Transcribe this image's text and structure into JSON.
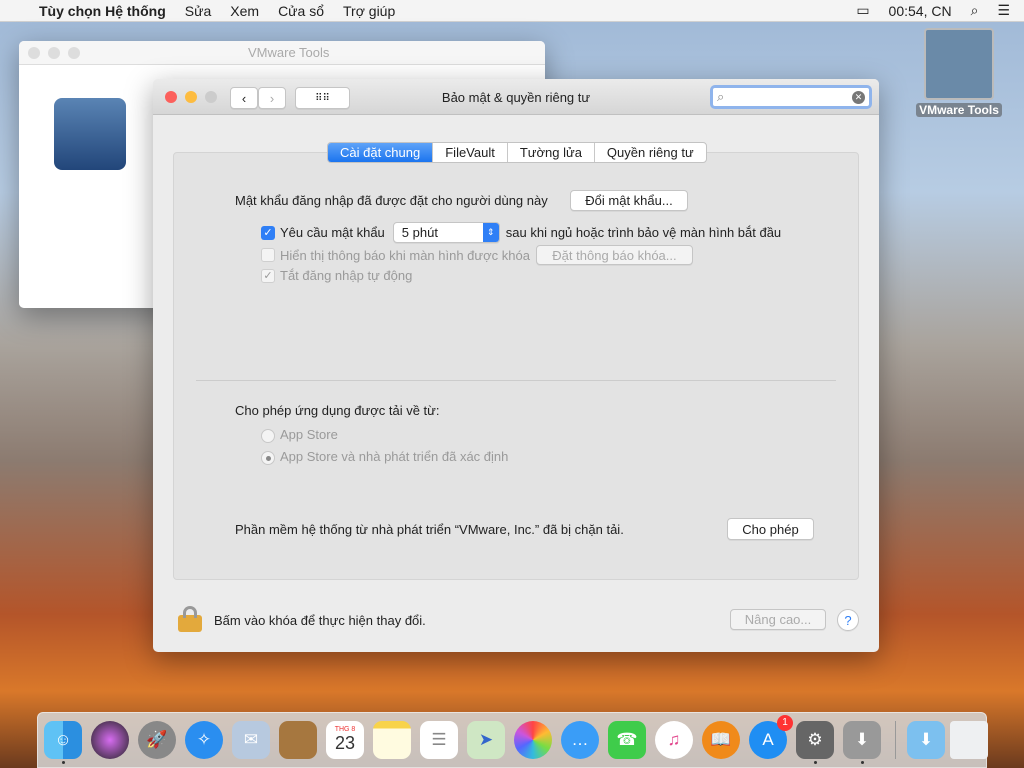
{
  "menubar": {
    "app": "Tùy chọn Hệ thống",
    "items": [
      "Sửa",
      "Xem",
      "Cửa sổ",
      "Trợ giúp"
    ],
    "clock": "00:54, CN"
  },
  "desktop": {
    "icon_label": "VMware Tools"
  },
  "back_window": {
    "title": "VMware Tools"
  },
  "window": {
    "title": "Bảo mật & quyền riêng tư",
    "search_value": "",
    "tabs": [
      "Cài đặt chung",
      "FileVault",
      "Tường lửa",
      "Quyền riêng tư"
    ],
    "password_text": "Mật khẩu đăng nhập đã được đặt cho người dùng này",
    "change_password": "Đổi mật khẩu...",
    "require_password": "Yêu cầu mật khẩu",
    "require_delay": "5 phút",
    "require_suffix": "sau khi ngủ hoặc trình bảo vệ màn hình bắt đầu",
    "show_message": "Hiển thị thông báo khi màn hình được khóa",
    "set_message": "Đặt thông báo khóa...",
    "disable_autologin": "Tắt đăng nhập tự động",
    "allow_apps": "Cho phép ứng dụng được tải về từ:",
    "opt_appstore": "App Store",
    "opt_identified": "App Store và nhà phát triển đã xác định",
    "blocked_text": "Phần mềm hệ thống từ nhà phát triển “VMware, Inc.” đã bị chặn tải.",
    "allow": "Cho phép",
    "lock_text": "Bấm vào khóa để thực hiện thay đổi.",
    "advanced": "Nâng cao...",
    "help": "?"
  },
  "dock": {
    "calendar_month": "THG 8",
    "calendar_day": "23",
    "appstore_badge": "1",
    "apps": [
      "Finder",
      "Siri",
      "Launchpad",
      "Safari",
      "Mail",
      "Contacts",
      "Calendar",
      "Notes",
      "Reminders",
      "Maps",
      "Photos",
      "Messages",
      "FaceTime",
      "iTunes",
      "iBooks",
      "App Store",
      "System Preferences",
      "Installer",
      "Downloads",
      "Trash"
    ]
  }
}
